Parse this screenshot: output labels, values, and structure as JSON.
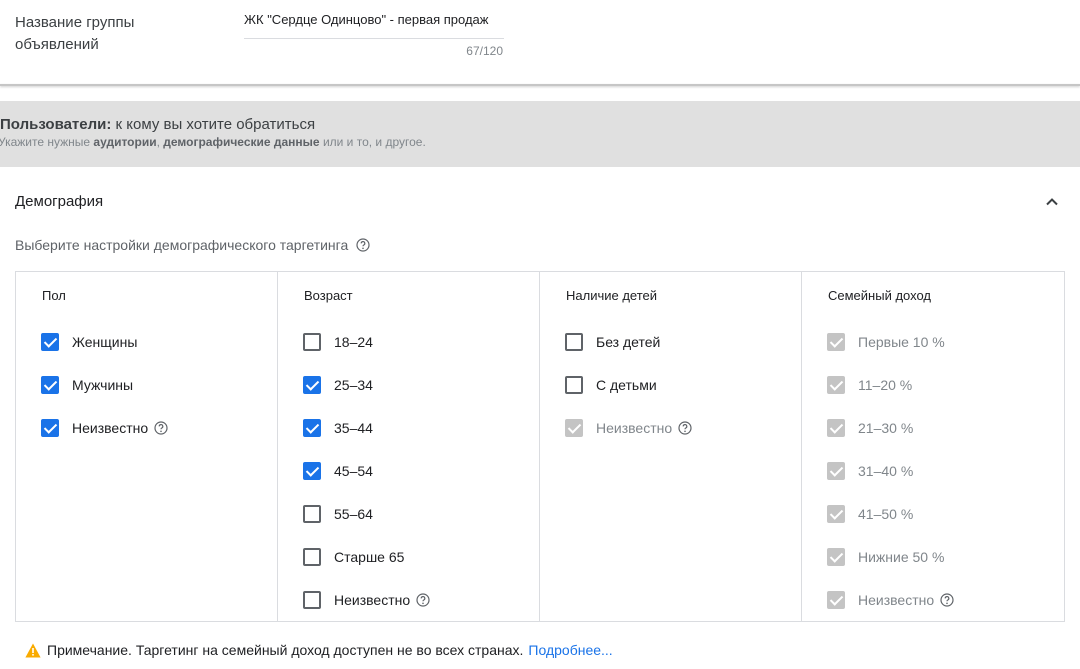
{
  "ad_group": {
    "label": "Название группы объявлений",
    "value": "ЖК \"Сердце Одинцово\" - первая продаж",
    "counter": "67/120"
  },
  "users": {
    "title_bold": "Пользователи:",
    "title_rest": " к кому вы хотите обратиться",
    "sub_pre": "Укажите нужные ",
    "sub_b1": "аудитории",
    "sub_mid": ", ",
    "sub_b2": "демографические данные",
    "sub_post": " или и то, и другое."
  },
  "demography": {
    "title": "Демография",
    "hint": "Выберите настройки демографического таргетинга",
    "columns": [
      {
        "header": "Пол",
        "options": [
          {
            "label": "Женщины",
            "checked": true,
            "disabled": false
          },
          {
            "label": "Мужчины",
            "checked": true,
            "disabled": false
          },
          {
            "label": "Неизвестно",
            "checked": true,
            "disabled": false,
            "help": true
          }
        ]
      },
      {
        "header": "Возраст",
        "options": [
          {
            "label": "18–24",
            "checked": false,
            "disabled": false
          },
          {
            "label": "25–34",
            "checked": true,
            "disabled": false
          },
          {
            "label": "35–44",
            "checked": true,
            "disabled": false
          },
          {
            "label": "45–54",
            "checked": true,
            "disabled": false
          },
          {
            "label": "55–64",
            "checked": false,
            "disabled": false
          },
          {
            "label": "Старше 65",
            "checked": false,
            "disabled": false
          },
          {
            "label": "Неизвестно",
            "checked": false,
            "disabled": false,
            "help": true
          }
        ]
      },
      {
        "header": "Наличие детей",
        "options": [
          {
            "label": "Без детей",
            "checked": false,
            "disabled": false
          },
          {
            "label": "С детьми",
            "checked": false,
            "disabled": false
          },
          {
            "label": "Неизвестно",
            "checked": true,
            "disabled": true,
            "help": true
          }
        ]
      },
      {
        "header": "Семейный доход",
        "options": [
          {
            "label": "Первые 10 %",
            "checked": true,
            "disabled": true
          },
          {
            "label": "11–20 %",
            "checked": true,
            "disabled": true
          },
          {
            "label": "21–30 %",
            "checked": true,
            "disabled": true
          },
          {
            "label": "31–40 %",
            "checked": true,
            "disabled": true
          },
          {
            "label": "41–50 %",
            "checked": true,
            "disabled": true
          },
          {
            "label": "Нижние 50 %",
            "checked": true,
            "disabled": true
          },
          {
            "label": "Неизвестно",
            "checked": true,
            "disabled": true,
            "help": true
          }
        ]
      }
    ],
    "note_text": "Примечание. Таргетинг на семейный доход доступен не во всех странах.",
    "note_link": "Подробнее..."
  },
  "colors": {
    "accent": "#1a73e8",
    "disabled_check": "#c4c4c4",
    "warning": "#f9ab00",
    "band_bg": "#e0e0e0"
  },
  "icons": {
    "help": "question-circle-icon",
    "collapse": "chevron-up-icon",
    "warning": "warning-triangle-icon"
  }
}
